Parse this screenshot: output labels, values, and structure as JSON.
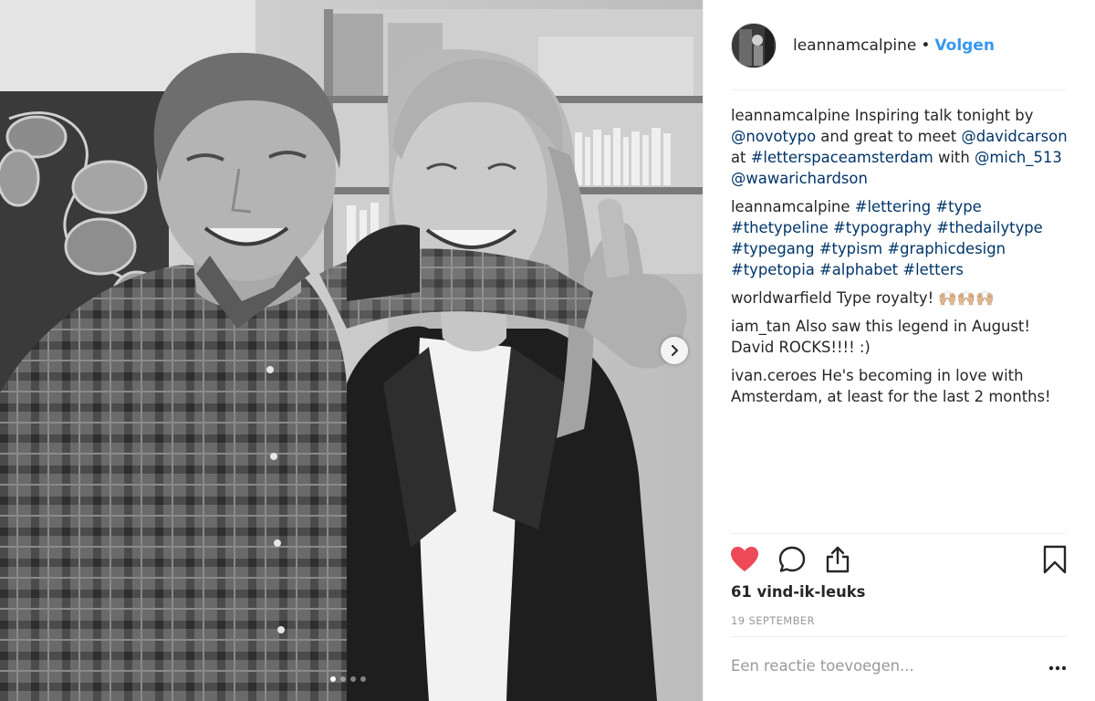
{
  "post": {
    "author": "leannamcalpine",
    "separator": "•",
    "follow_label": "Volgen",
    "likes_text": "61 vind-ik-leuks",
    "date_text": "19 SEPTEMBER",
    "comment_placeholder": "Een reactie toevoegen...",
    "carousel": {
      "count": 4,
      "active_index": 0
    }
  },
  "comments": [
    {
      "user": "leannamcalpine",
      "parts": [
        {
          "type": "text",
          "value": " Inspiring talk tonight by "
        },
        {
          "type": "tag",
          "value": "@novotypo"
        },
        {
          "type": "text",
          "value": " and great to meet "
        },
        {
          "type": "tag",
          "value": "@davidcarson"
        },
        {
          "type": "text",
          "value": " at "
        },
        {
          "type": "tag",
          "value": "#letterspaceamsterdam"
        },
        {
          "type": "text",
          "value": " with "
        },
        {
          "type": "tag",
          "value": "@mich_513"
        },
        {
          "type": "text",
          "value": " "
        },
        {
          "type": "tag",
          "value": "@wawarichardson"
        }
      ]
    },
    {
      "user": "leannamcalpine",
      "parts": [
        {
          "type": "text",
          "value": " "
        },
        {
          "type": "tag",
          "value": "#lettering"
        },
        {
          "type": "text",
          "value": " "
        },
        {
          "type": "tag",
          "value": "#type"
        },
        {
          "type": "text",
          "value": " "
        },
        {
          "type": "tag",
          "value": "#thetypeline"
        },
        {
          "type": "text",
          "value": " "
        },
        {
          "type": "tag",
          "value": "#typography"
        },
        {
          "type": "text",
          "value": " "
        },
        {
          "type": "tag",
          "value": "#thedailytype"
        },
        {
          "type": "text",
          "value": " "
        },
        {
          "type": "tag",
          "value": "#typegang"
        },
        {
          "type": "text",
          "value": " "
        },
        {
          "type": "tag",
          "value": "#typism"
        },
        {
          "type": "text",
          "value": " "
        },
        {
          "type": "tag",
          "value": "#graphicdesign"
        },
        {
          "type": "text",
          "value": " "
        },
        {
          "type": "tag",
          "value": "#typetopia"
        },
        {
          "type": "text",
          "value": " "
        },
        {
          "type": "tag",
          "value": "#alphabet"
        },
        {
          "type": "text",
          "value": " "
        },
        {
          "type": "tag",
          "value": "#letters"
        }
      ]
    },
    {
      "user": "worldwarfield",
      "parts": [
        {
          "type": "text",
          "value": " Type royalty! 🙌🏼🙌🏼🙌🏼"
        }
      ]
    },
    {
      "user": "iam_tan",
      "parts": [
        {
          "type": "text",
          "value": " Also saw this legend in August! David ROCKS!!!! :)"
        }
      ]
    },
    {
      "user": "ivan.ceroes",
      "parts": [
        {
          "type": "text",
          "value": " He's becoming in love with Amsterdam, at least for the last 2 months!"
        }
      ]
    }
  ],
  "icons": {
    "like": "heart-icon",
    "comment": "comment-bubble-icon",
    "share": "share-icon",
    "save": "bookmark-icon",
    "more": "more-dots-icon",
    "next": "chevron-right-icon"
  },
  "colors": {
    "link": "#003569",
    "follow": "#3897f0",
    "like": "#ed4956",
    "muted": "#999999",
    "divider": "#efefef"
  }
}
